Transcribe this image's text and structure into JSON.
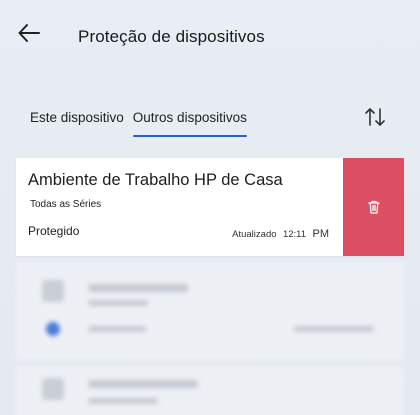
{
  "header": {
    "back_icon": "arrow-left-icon",
    "title": "Proteção de dispositivos"
  },
  "tabs": [
    {
      "label": "Este dispositivo",
      "active": false
    },
    {
      "label": "Outros dispositivos",
      "active": true
    }
  ],
  "sort_icon": "sort-arrows-icon",
  "device": {
    "name": "Ambiente de Trabalho HP de Casa",
    "subtitle": "Todas as Séries",
    "status": "Protegido",
    "updated_label": "Atualizado",
    "updated_time": "12:11",
    "updated_ampm": "PM",
    "delete_icon": "trash-icon",
    "delete_color": "#dc4f63"
  },
  "colors": {
    "accent": "#2a62c8",
    "delete": "#dc4f63"
  }
}
